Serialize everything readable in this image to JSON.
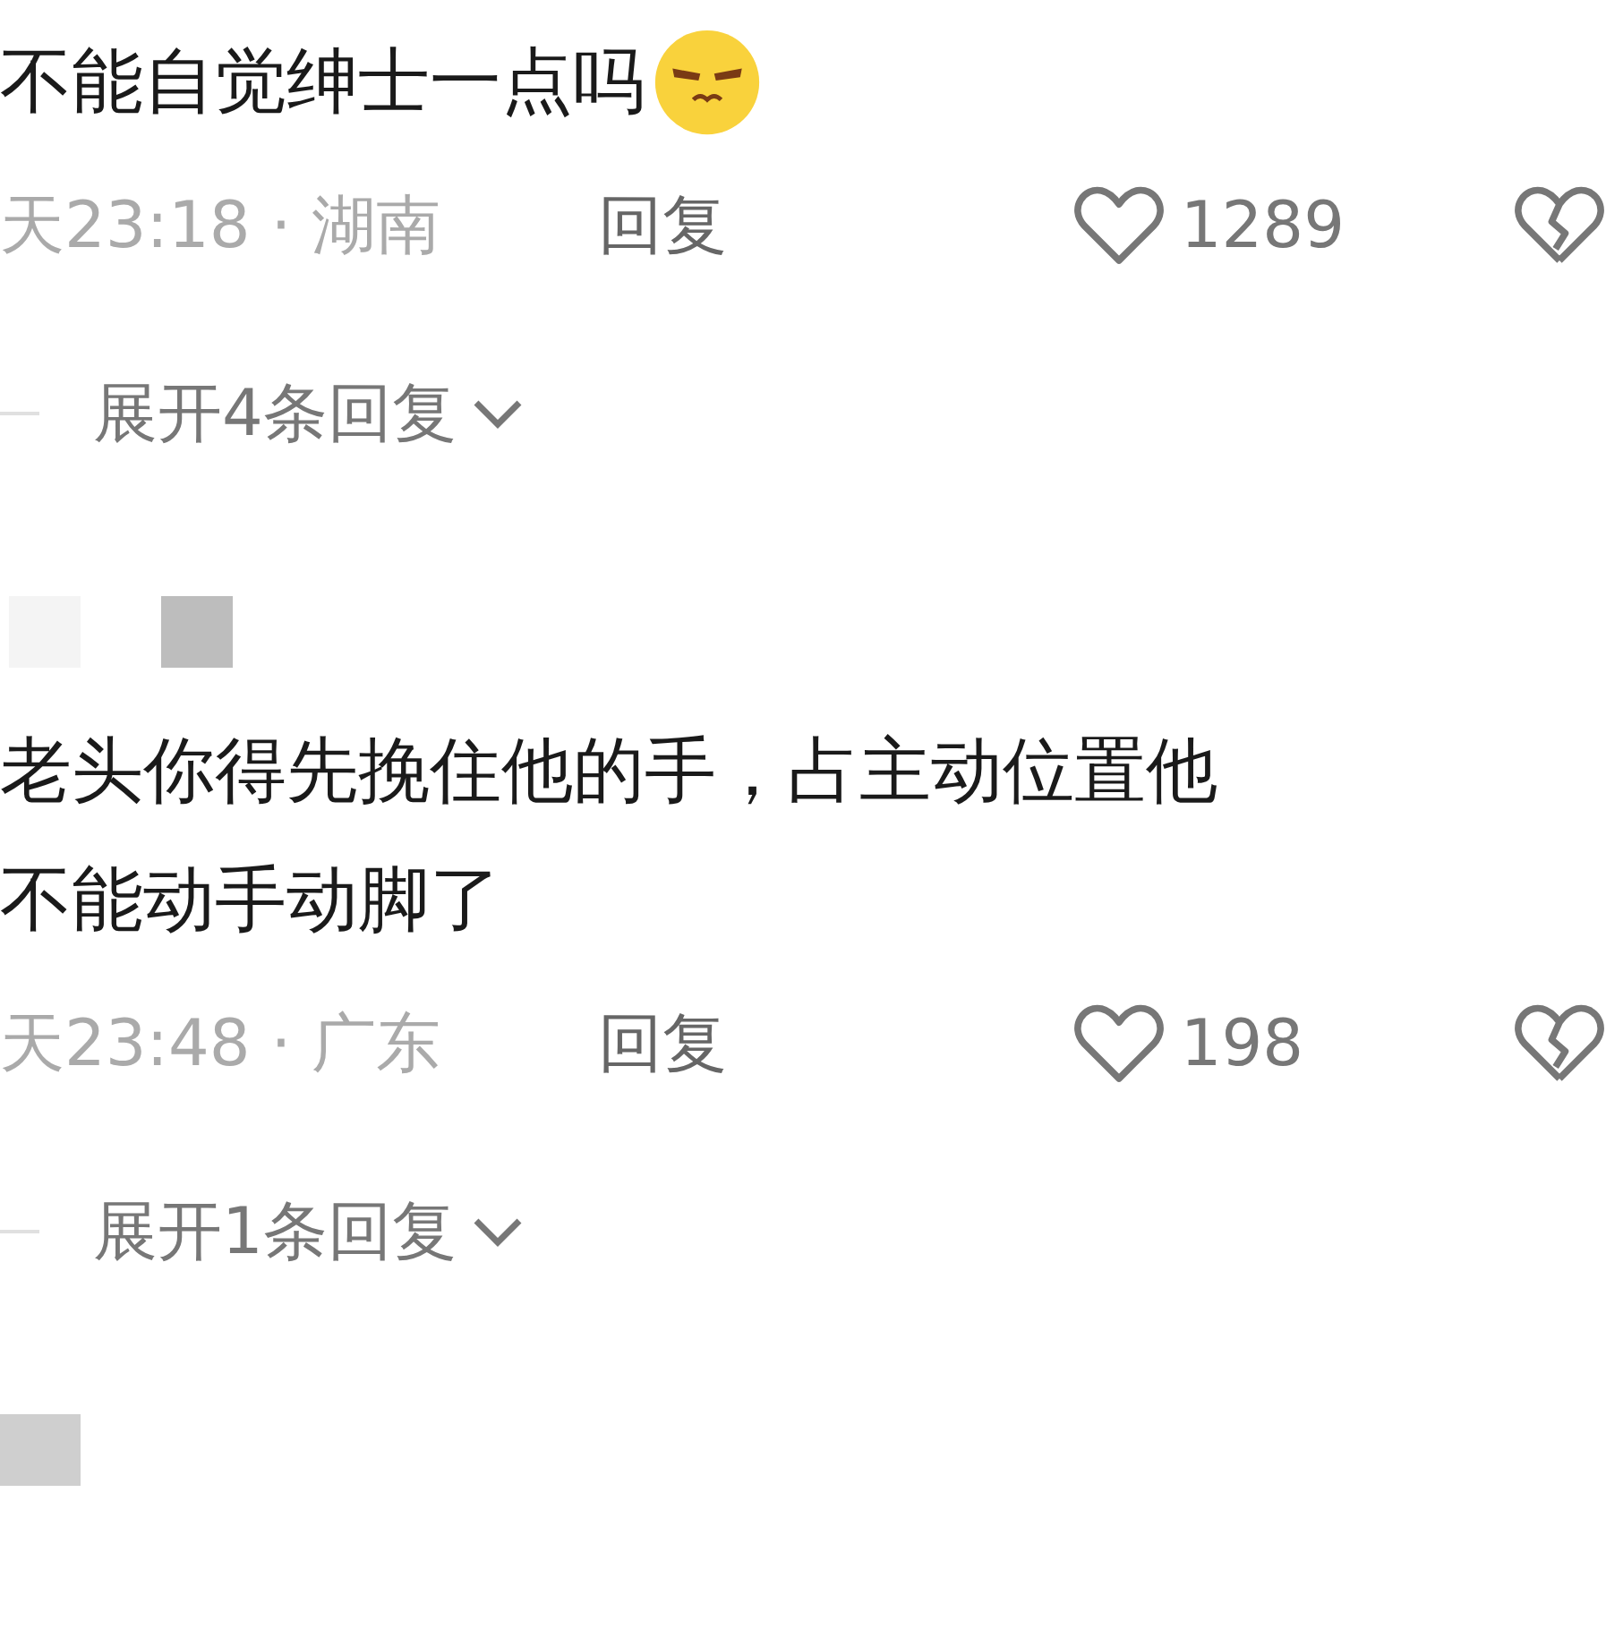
{
  "items": [
    {
      "kind": "text",
      "text_lines": [
        "不能自觉绅士一点吗"
      ],
      "emoji": true
    },
    {
      "kind": "meta",
      "time": "天23:18 · 湖南",
      "reply": "回复",
      "likes": "1289"
    },
    {
      "kind": "expand",
      "label": "展开4条回复"
    },
    {
      "kind": "redacted-pair"
    },
    {
      "kind": "text",
      "text_lines": [
        "老头你得先挽住他的手，占主动位置他",
        "不能动手动脚了"
      ]
    },
    {
      "kind": "meta",
      "time": "天23:48 · 广东",
      "reply": "回复",
      "likes": "198"
    },
    {
      "kind": "expand",
      "label": "展开1条回复"
    },
    {
      "kind": "redacted-single"
    }
  ]
}
